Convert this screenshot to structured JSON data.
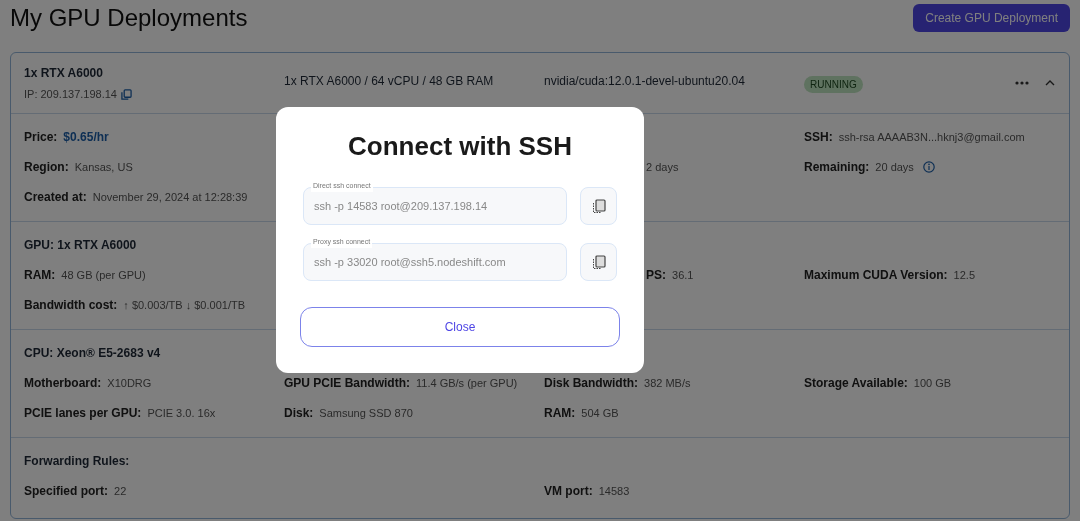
{
  "page_title": "My GPU Deployments",
  "create_button": "Create GPU Deployment",
  "deployment": {
    "name": "1x RTX A6000",
    "ip": "IP: 209.137.198.14",
    "spec": "1x RTX A6000 / 64 vCPU / 48 GB RAM",
    "image": "nvidia/cuda:12.0.1-devel-ubuntu20.04",
    "status": {
      "label": "RUNNING",
      "kind": "running"
    },
    "expanded": true,
    "sections": [
      {
        "rows": [
          [
            {
              "kind": "price",
              "label": "Price:",
              "value": "$0.65/hr"
            },
            null,
            null,
            {
              "kind": "plain",
              "label": "SSH:",
              "value": "ssh-rsa AAAAB3N...hknj3@gmail.com"
            }
          ],
          [
            {
              "kind": "plain",
              "label": "Region:",
              "value": "Kansas, US"
            },
            null,
            {
              "kind": "partial",
              "value": "2 days"
            },
            {
              "kind": "info",
              "label": "Remaining:",
              "value": "20 days"
            }
          ],
          [
            {
              "kind": "plain",
              "label": "Created at:",
              "value": "November 29, 2024 at 12:28:39"
            },
            null,
            null,
            null
          ]
        ]
      },
      {
        "heading": "GPU: 1x RTX A6000",
        "rows": [
          [
            {
              "kind": "plain",
              "label": "RAM:",
              "value": "48 GB (per GPU)"
            },
            null,
            {
              "kind": "partial",
              "label": "PS:",
              "value": "36.1"
            },
            {
              "kind": "plain",
              "label": "Maximum CUDA Version:",
              "value": "12.5"
            }
          ],
          [
            {
              "kind": "plain",
              "label": "Bandwidth cost:",
              "value": "↑ $0.003/TB ↓ $0.001/TB"
            },
            null,
            null,
            null
          ]
        ]
      },
      {
        "heading": "CPU: Xeon® E5-2683 v4",
        "rows": [
          [
            {
              "kind": "plain",
              "label": "Motherboard:",
              "value": "X10DRG"
            },
            {
              "kind": "plain",
              "label": "GPU PCIE Bandwidth:",
              "value": "11.4 GB/s (per GPU)"
            },
            {
              "kind": "plain",
              "label": "Disk Bandwidth:",
              "value": "382 MB/s"
            },
            {
              "kind": "plain",
              "label": "Storage Available:",
              "value": "100 GB"
            }
          ],
          [
            {
              "kind": "plain",
              "label": "PCIE lanes per GPU:",
              "value": "PCIE 3.0. 16x"
            },
            {
              "kind": "plain",
              "label": "Disk:",
              "value": "Samsung SSD 870"
            },
            {
              "kind": "plain",
              "label": "RAM:",
              "value": "504 GB"
            },
            null
          ]
        ]
      },
      {
        "heading": "Forwarding Rules:",
        "rows": [
          [
            {
              "kind": "plain",
              "label": "Specified port:",
              "value": "22"
            },
            null,
            {
              "kind": "plain",
              "label": "VM port:",
              "value": "14583"
            },
            null
          ]
        ]
      }
    ]
  },
  "dialog": {
    "title": "Connect with SSH",
    "fields": [
      {
        "label": "Direct ssh connect",
        "value": "ssh -p 14583 root@209.137.198.14"
      },
      {
        "label": "Proxy ssh connect",
        "value": "ssh -p 33020 root@ssh5.nodeshift.com"
      }
    ],
    "close_button": "Close"
  }
}
